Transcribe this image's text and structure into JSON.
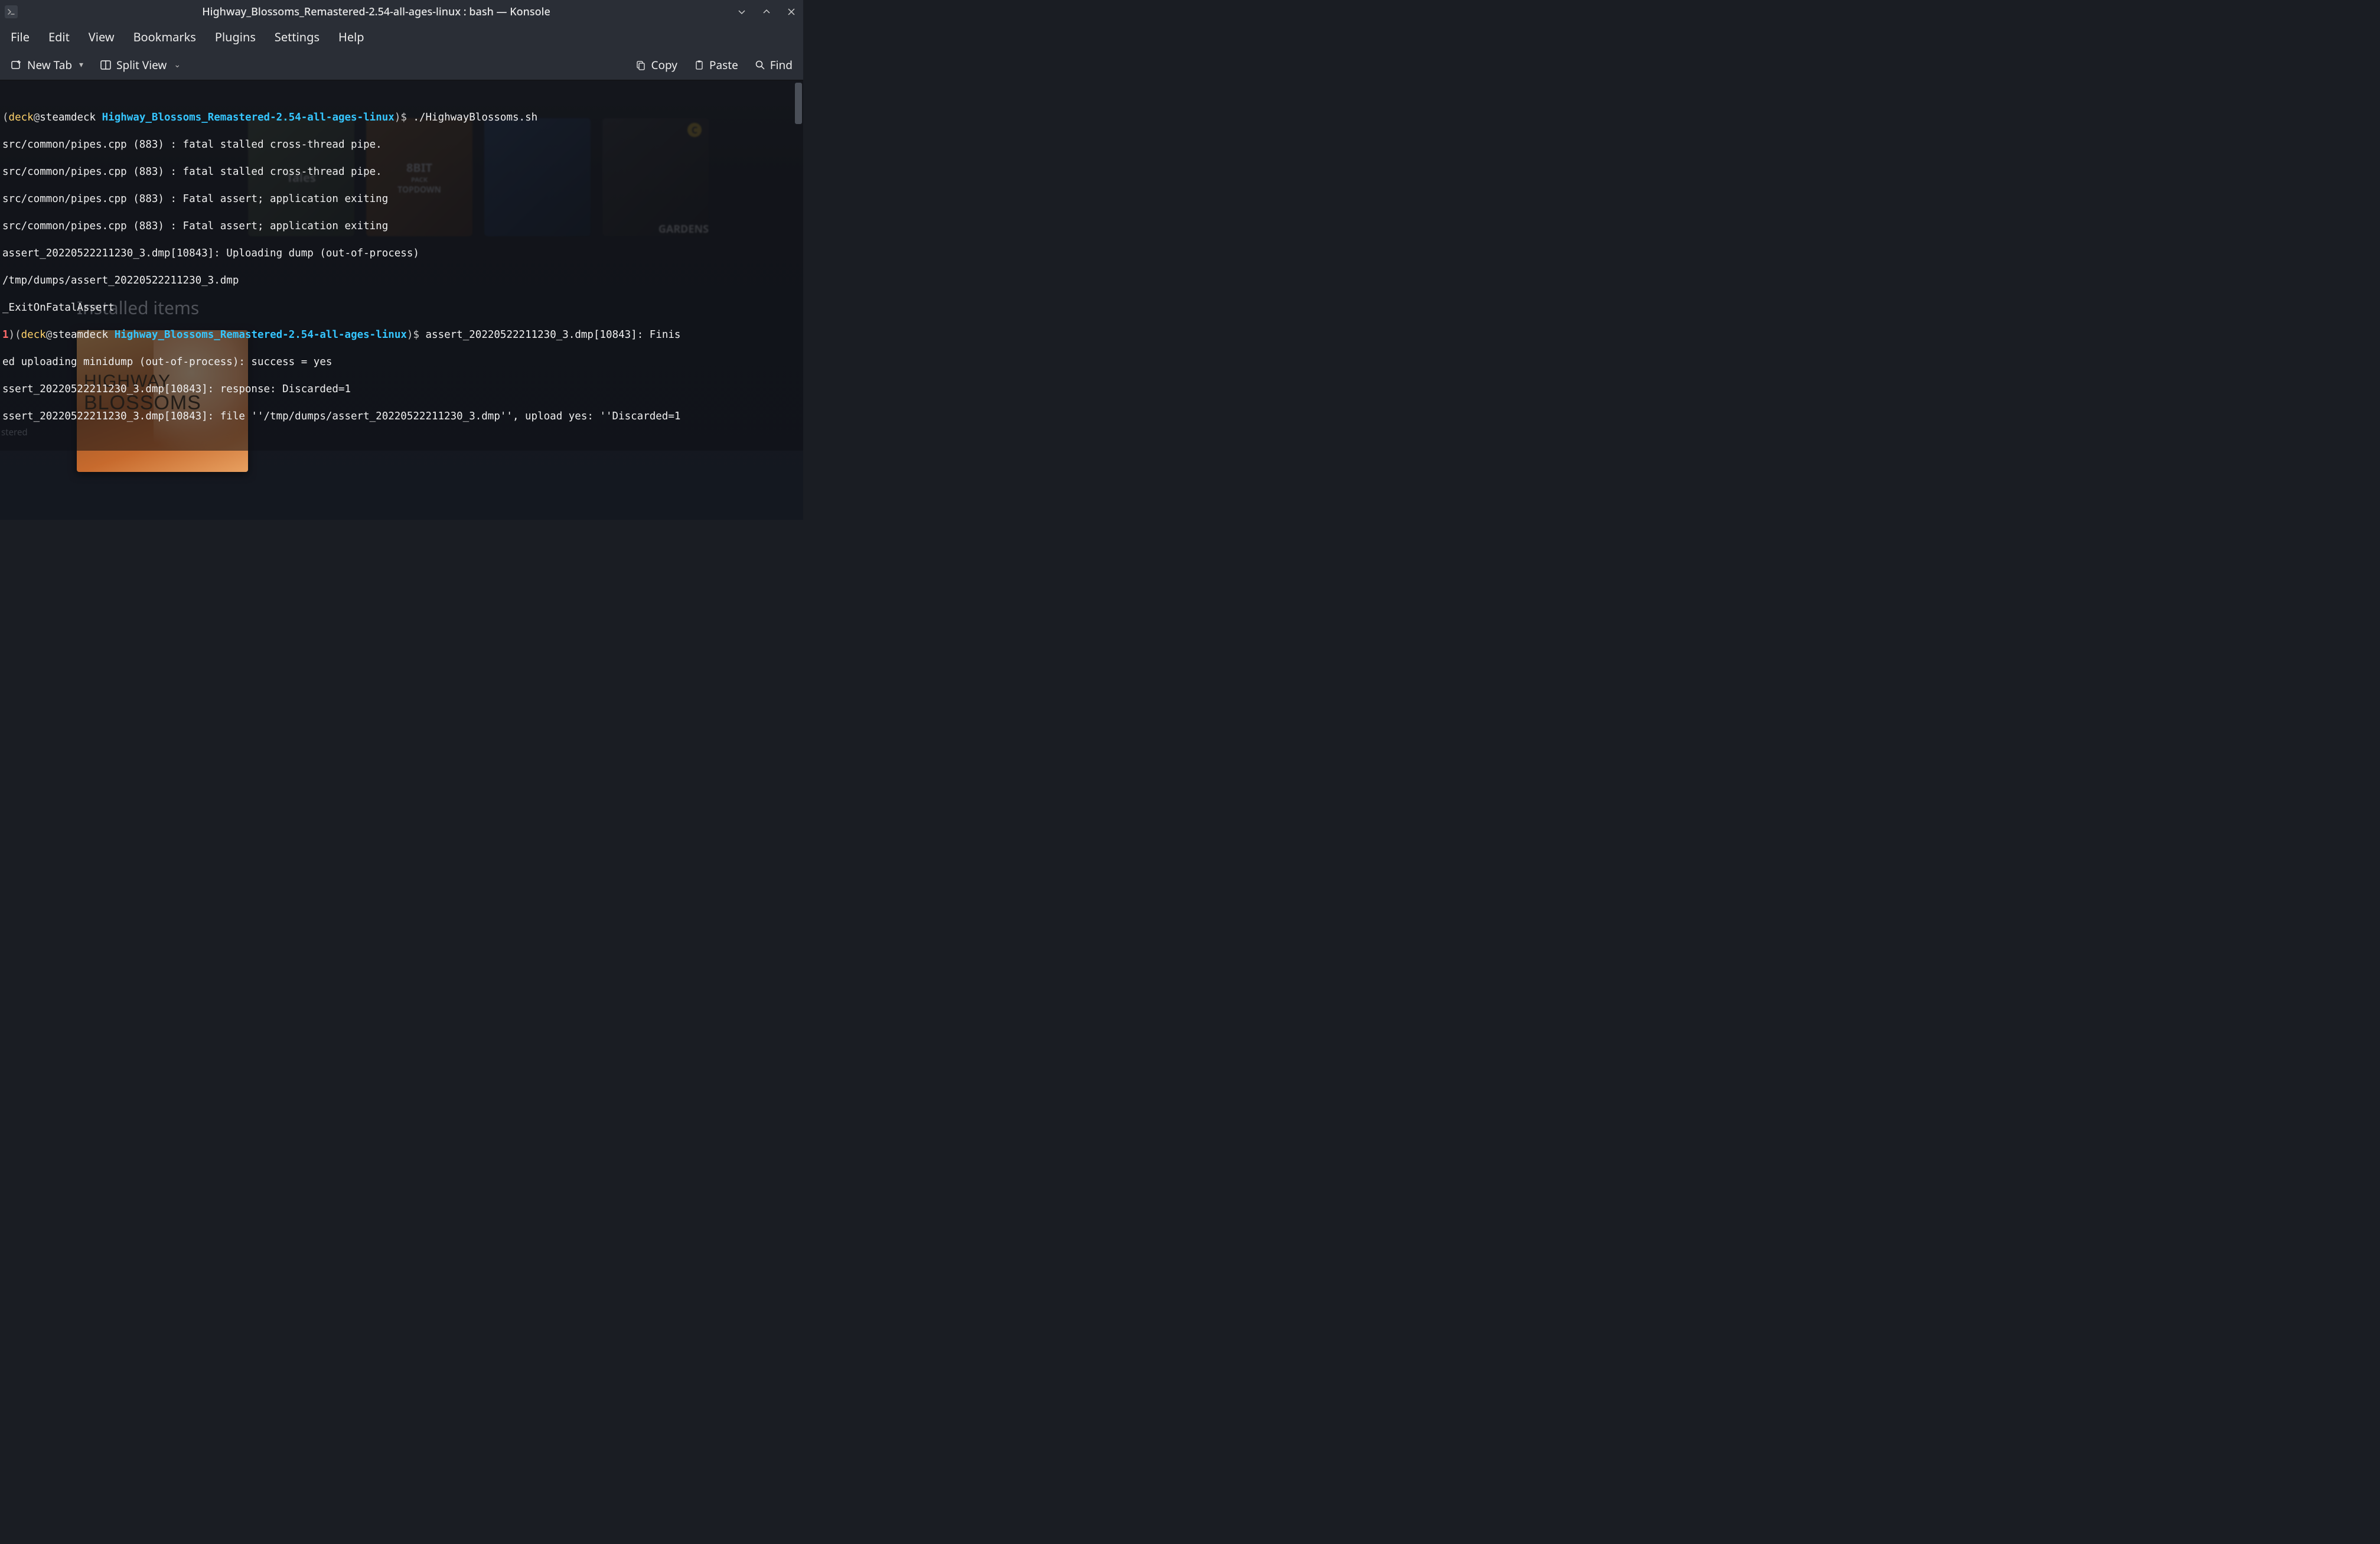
{
  "window": {
    "title": "Highway_Blossoms_Remastered-2.54-all-ages-linux : bash — Konsole"
  },
  "menubar": [
    "File",
    "Edit",
    "View",
    "Bookmarks",
    "Plugins",
    "Settings",
    "Help"
  ],
  "toolbar": {
    "newtab": "New Tab",
    "split": "Split View",
    "copy": "Copy",
    "paste": "Paste",
    "find": "Find"
  },
  "prompt": {
    "user": "deck",
    "host": "steamdeck",
    "cwd": "Highway_Blossoms_Remastered-2.54-all-ages-linux",
    "errcode": "1",
    "cmd1": "./HighwayBlossoms.sh",
    "cmd2": "assert_20220522211230_3.dmp[10843]: Finis"
  },
  "term": {
    "l1": "src/common/pipes.cpp (883) : fatal stalled cross-thread pipe.",
    "l2": "src/common/pipes.cpp (883) : fatal stalled cross-thread pipe.",
    "l3": "src/common/pipes.cpp (883) : Fatal assert; application exiting",
    "l4": "src/common/pipes.cpp (883) : Fatal assert; application exiting",
    "l5": "assert_20220522211230_3.dmp[10843]: Uploading dump (out-of-process)",
    "l6": "/tmp/dumps/assert_20220522211230_3.dmp",
    "l7": "_ExitOnFatalAssert",
    "l8": "ed uploading minidump (out-of-process): success = yes",
    "l9": "ssert_20220522211230_3.dmp[10843]: response: Discarded=1",
    "l10": "ssert_20220522211230_3.dmp[10843]: file ''/tmp/dumps/assert_20220522211230_3.dmp'', upload yes: ''Discarded=1"
  },
  "bg": {
    "tile1a": "Tales",
    "tile2a": "8BIT",
    "tile2b": "PACK",
    "tile2c": "TOPDOWN",
    "tile3a": "C",
    "tile4a": "GARDENS"
  },
  "installed": {
    "heading": "Installed items",
    "game_l1": "HIGHWAY",
    "game_l2": "BLOSSOMS"
  },
  "misc": {
    "stered": "stered"
  }
}
